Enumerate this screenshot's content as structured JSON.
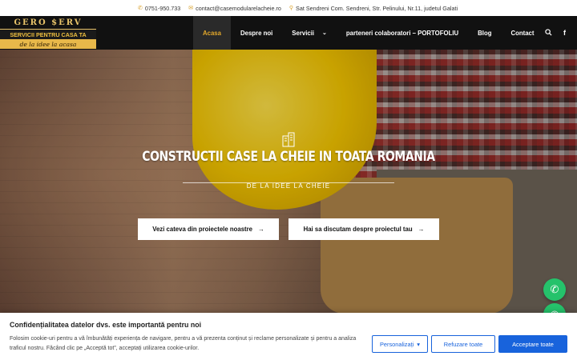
{
  "topbar": {
    "phone": "0751-950.733",
    "email": "contact@casemodularelacheie.ro",
    "address": "Sat Sendreni Com. Sendreni, Str. Pelinului, Nr.11, judetul Galati"
  },
  "logo": {
    "brand": "GERO $ERV",
    "tagline": "SERVICII PENTRU CASA TA",
    "slogan": "de la idee la acasa"
  },
  "nav": {
    "items": [
      {
        "label": "Acasa",
        "active": true
      },
      {
        "label": "Despre noi"
      },
      {
        "label": "Servicii",
        "has_dropdown": true
      },
      {
        "label": "parteneri colaboratori – PORTOFOLIU"
      },
      {
        "label": "Blog"
      },
      {
        "label": "Contact"
      }
    ]
  },
  "hero": {
    "title": "CONSTRUCTII CASE LA CHEIE IN TOATA ROMANIA",
    "subtitle": "DE LA IDEE LA CHEIE",
    "button1": "Vezi cateva din proiectele noastre",
    "button2": "Hai sa discutam despre proiectul tau"
  },
  "cookie": {
    "title": "Confidențialitatea datelor dvs. este importantă pentru noi",
    "text": "Folosim cookie-uri pentru a vă îmbunătăți experiența de navigare, pentru a vă prezenta conținut și reclame personalizate și pentru a analiza traficul nostru. Făcând clic pe „Acceptă tot”, acceptați utilizarea cookie-urilor.",
    "customize": "Personalizați",
    "reject": "Refuzare toate",
    "accept": "Acceptare toate"
  },
  "colors": {
    "accent": "#e3a82b",
    "cookie_blue": "#1863dc",
    "fab_green": "#25c26b"
  }
}
